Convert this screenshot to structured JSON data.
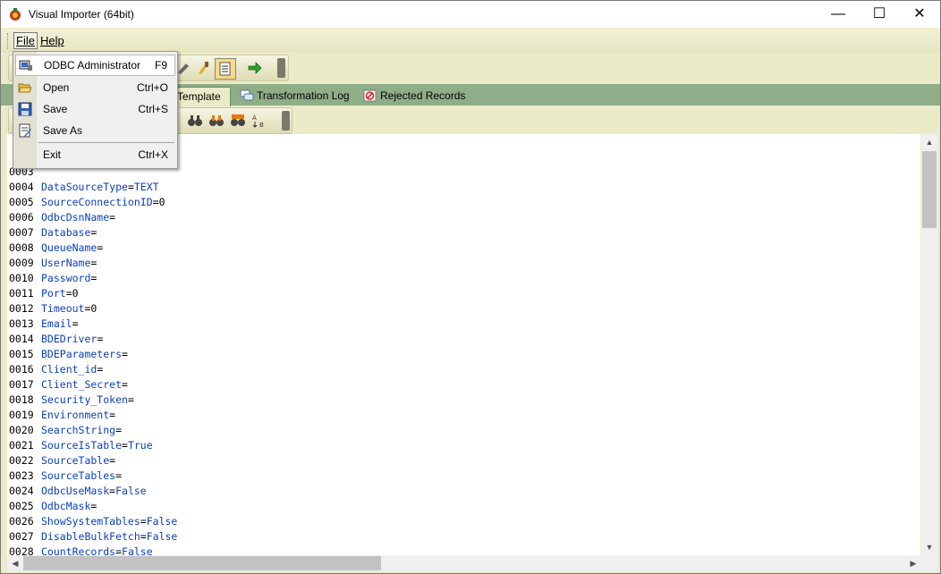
{
  "window": {
    "title": "Visual Importer (64bit)",
    "controls": {
      "minimize": "—",
      "maximize": "☐",
      "close": "✕"
    }
  },
  "menubar": {
    "file_label": "File",
    "help_label": "Help"
  },
  "file_menu": {
    "items": [
      {
        "label": "ODBC Administrator",
        "shortcut": "F9",
        "icon": "odbc-icon"
      },
      {
        "label": "Open",
        "shortcut": "Ctrl+O",
        "icon": "folder-open-icon"
      },
      {
        "label": "Save",
        "shortcut": "Ctrl+S",
        "icon": "floppy-disk-icon"
      },
      {
        "label": "Save As",
        "shortcut": "",
        "icon": "save-as-icon"
      },
      {
        "label": "Exit",
        "shortcut": "Ctrl+X",
        "icon": ""
      }
    ]
  },
  "tabs": [
    {
      "label": "Template",
      "active": true
    },
    {
      "label": "Transformation Log",
      "active": false
    },
    {
      "label": "Rejected Records",
      "active": false
    }
  ],
  "editor": {
    "lines": [
      {
        "num": "0003",
        "key": "",
        "value": ""
      },
      {
        "num": "0004",
        "key": "DataSourceType",
        "value": "TEXT"
      },
      {
        "num": "0005",
        "key": "SourceConnectionID",
        "value": "0"
      },
      {
        "num": "0006",
        "key": "OdbcDsnName",
        "value": ""
      },
      {
        "num": "0007",
        "key": "Database",
        "value": ""
      },
      {
        "num": "0008",
        "key": "QueueName",
        "value": ""
      },
      {
        "num": "0009",
        "key": "UserName",
        "value": ""
      },
      {
        "num": "0010",
        "key": "Password",
        "value": ""
      },
      {
        "num": "0011",
        "key": "Port",
        "value": "0"
      },
      {
        "num": "0012",
        "key": "Timeout",
        "value": "0"
      },
      {
        "num": "0013",
        "key": "Email",
        "value": ""
      },
      {
        "num": "0014",
        "key": "BDEDriver",
        "value": ""
      },
      {
        "num": "0015",
        "key": "BDEParameters",
        "value": ""
      },
      {
        "num": "0016",
        "key": "Client_id",
        "value": ""
      },
      {
        "num": "0017",
        "key": "Client_Secret",
        "value": ""
      },
      {
        "num": "0018",
        "key": "Security_Token",
        "value": ""
      },
      {
        "num": "0019",
        "key": "Environment",
        "value": ""
      },
      {
        "num": "0020",
        "key": "SearchString",
        "value": ""
      },
      {
        "num": "0021",
        "key": "SourceIsTable",
        "value": "True"
      },
      {
        "num": "0022",
        "key": "SourceTable",
        "value": ""
      },
      {
        "num": "0023",
        "key": "SourceTables",
        "value": ""
      },
      {
        "num": "0024",
        "key": "OdbcUseMask",
        "value": "False"
      },
      {
        "num": "0025",
        "key": "OdbcMask",
        "value": ""
      },
      {
        "num": "0026",
        "key": "ShowSystemTables",
        "value": "False"
      },
      {
        "num": "0027",
        "key": "DisableBulkFetch",
        "value": "False"
      },
      {
        "num": "0028",
        "key": "CountRecords",
        "value": "False"
      }
    ]
  },
  "colors": {
    "chrome": "#ecebc9",
    "tabstrip": "#8fae88",
    "keyword": "#0a3ebd"
  }
}
